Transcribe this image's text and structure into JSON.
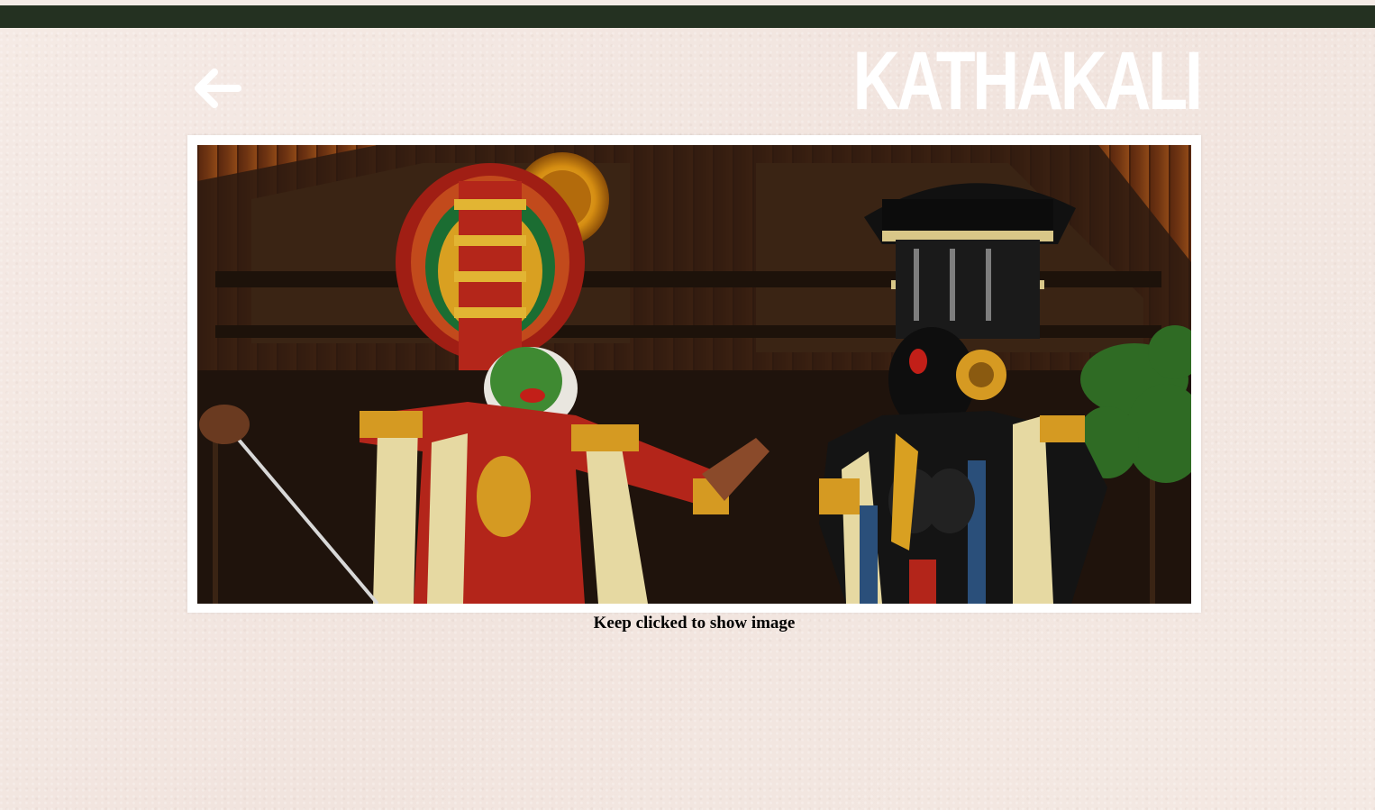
{
  "header": {
    "back_icon": "arrow-left-icon",
    "title": "KATHAKALI"
  },
  "photo": {
    "subject": "kathakali-performers-photo"
  },
  "caption": {
    "text": "Keep clicked to show image"
  },
  "colors": {
    "top_bar": "#243121",
    "background": "#f3e7e1",
    "frame": "#ffffff",
    "title": "#ffffff"
  }
}
